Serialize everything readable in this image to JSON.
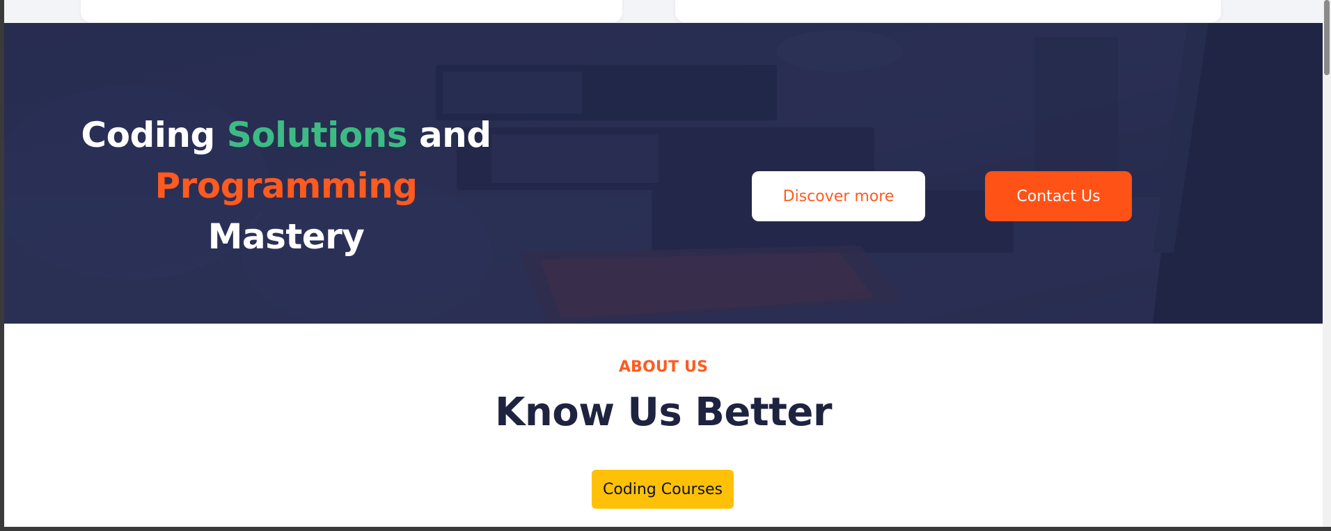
{
  "hero": {
    "title_part1": "Coding ",
    "title_highlight1": "Solutions",
    "title_part2": " and",
    "title_highlight2": "Programming",
    "title_part3": " Mastery",
    "discover_label": "Discover more",
    "contact_label": "Contact Us"
  },
  "about": {
    "label": "ABOUT US",
    "title": "Know Us Better",
    "tag_label": "Coding Courses"
  },
  "colors": {
    "accent_orange": "#ff5a1f",
    "accent_green": "#3dbb84",
    "hero_navy": "#2a2f52",
    "heading_navy": "#1e2340",
    "tag_yellow": "#ffc107"
  }
}
